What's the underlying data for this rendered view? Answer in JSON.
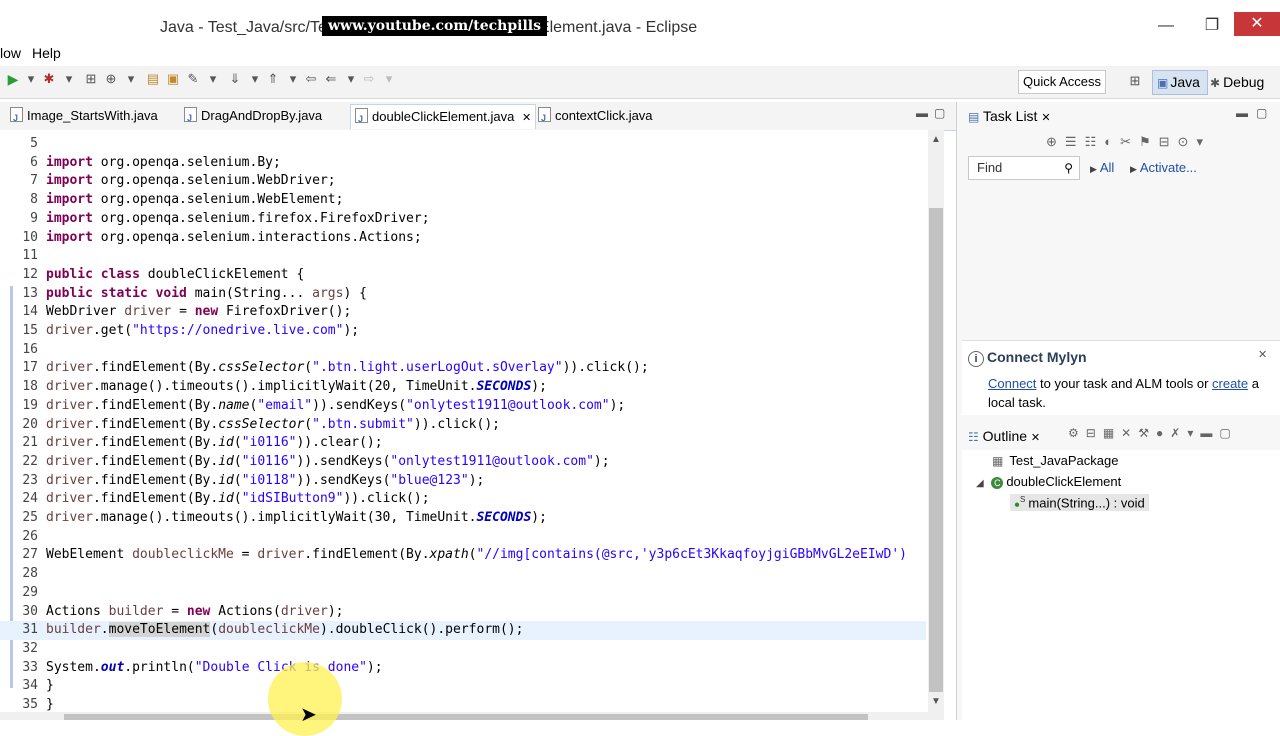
{
  "window": {
    "title": "Java - Test_Java/src/Te",
    "title_suffix": "Element.java - Eclipse",
    "watermark": "www.youtube.com/techpills",
    "min_symbol": "—",
    "max_symbol": "❐",
    "close_symbol": "✕"
  },
  "menu": {
    "items": [
      "low",
      "Help"
    ]
  },
  "toolbar": {
    "quick_access": "Quick Access",
    "perspectives": [
      "Java",
      "Debug"
    ]
  },
  "editor": {
    "tabs": [
      {
        "label": "Image_StartsWith.java",
        "active": false
      },
      {
        "label": "DragAndDropBy.java",
        "active": false
      },
      {
        "label": "doubleClickElement.java",
        "active": true,
        "close": "✕"
      },
      {
        "label": "contextClick.java",
        "active": false
      }
    ],
    "lines": [
      {
        "n": "5",
        "html": ""
      },
      {
        "n": "6",
        "html": "<span class='kw'>import</span> org.openqa.selenium.By;"
      },
      {
        "n": "7",
        "html": "<span class='kw'>import</span> org.openqa.selenium.WebDriver;"
      },
      {
        "n": "8",
        "html": "<span class='kw'>import</span> org.openqa.selenium.WebElement;"
      },
      {
        "n": "9",
        "html": "<span class='kw'>import</span> org.openqa.selenium.firefox.FirefoxDriver;"
      },
      {
        "n": "10",
        "html": "<span class='kw'>import</span> org.openqa.selenium.interactions.Actions;"
      },
      {
        "n": "11",
        "html": ""
      },
      {
        "n": "12",
        "html": "<span class='kw'>public class</span> doubleClickElement {"
      },
      {
        "n": "13",
        "html": "<span class='kw'>public static void</span> main(String... <span class='var'>args</span>) {"
      },
      {
        "n": "14",
        "html": "WebDriver <span class='var'>driver</span> = <span class='kw'>new</span> FirefoxDriver();"
      },
      {
        "n": "15",
        "html": "<span class='var'>driver</span>.get(<span class='str'>\"https://onedrive.live.com\"</span>);"
      },
      {
        "n": "16",
        "html": ""
      },
      {
        "n": "17",
        "html": "<span class='var'>driver</span>.findElement(By.<span class='it'>cssSelector</span>(<span class='str'>\".btn.light.userLogOut.sOverlay\"</span>)).click();"
      },
      {
        "n": "18",
        "html": "<span class='var'>driver</span>.manage().timeouts().implicitlyWait(20, TimeUnit.<span class='static'>SECONDS</span>);"
      },
      {
        "n": "19",
        "html": "<span class='var'>driver</span>.findElement(By.<span class='it'>name</span>(<span class='str'>\"email\"</span>)).sendKeys(<span class='str'>\"onlytest1911@outlook.com\"</span>);"
      },
      {
        "n": "20",
        "html": "<span class='var'>driver</span>.findElement(By.<span class='it'>cssSelector</span>(<span class='str'>\".btn.submit\"</span>)).click();"
      },
      {
        "n": "21",
        "html": "<span class='var'>driver</span>.findElement(By.<span class='it'>id</span>(<span class='str'>\"i0116\"</span>)).clear();"
      },
      {
        "n": "22",
        "html": "<span class='var'>driver</span>.findElement(By.<span class='it'>id</span>(<span class='str'>\"i0116\"</span>)).sendKeys(<span class='str'>\"onlytest1911@outlook.com\"</span>);"
      },
      {
        "n": "23",
        "html": "<span class='var'>driver</span>.findElement(By.<span class='it'>id</span>(<span class='str'>\"i0118\"</span>)).sendKeys(<span class='str'>\"blue@123\"</span>);"
      },
      {
        "n": "24",
        "html": "<span class='var'>driver</span>.findElement(By.<span class='it'>id</span>(<span class='str'>\"idSIButton9\"</span>)).click();"
      },
      {
        "n": "25",
        "html": "<span class='var'>driver</span>.manage().timeouts().implicitlyWait(30, TimeUnit.<span class='static'>SECONDS</span>);"
      },
      {
        "n": "26",
        "html": ""
      },
      {
        "n": "27",
        "html": "WebElement <span class='var'>doubleclickMe</span> = <span class='var'>driver</span>.findElement(By.<span class='it'>xpath</span>(<span class='str'>\"//img[contains(@src,'y3p6cEt3KkaqfoyjgiGBbMvGL2eEIwD')</span>"
      },
      {
        "n": "28",
        "html": ""
      },
      {
        "n": "29",
        "html": ""
      },
      {
        "n": "30",
        "html": "Actions <span class='var'>builder</span> = <span class='kw'>new</span> Actions(<span class='var'>driver</span>);"
      },
      {
        "n": "31",
        "html": "<span class='var'>builder</span>.<span class='hl'>moveToElement</span>(<span class='var'>doubleclickMe</span>).doubleClick().perform();",
        "current": true
      },
      {
        "n": "32",
        "html": ""
      },
      {
        "n": "33",
        "html": "System.<span class='static'>out</span>.println(<span class='str'>\"Double Click is done\"</span>);"
      },
      {
        "n": "34",
        "html": "}"
      },
      {
        "n": "35",
        "html": "}"
      }
    ]
  },
  "task_list": {
    "title": "Task List",
    "find_placeholder": "Find",
    "all_label": "All",
    "activate_label": "Activate..."
  },
  "mylyn": {
    "title": "Connect Mylyn",
    "connect_link": "Connect",
    "text_mid": " to your task and ALM tools or ",
    "create_link": "create",
    "text_end": " a",
    "text_line2": "local task."
  },
  "outline": {
    "title": "Outline",
    "items": [
      {
        "label": "Test_JavaPackage",
        "level": 0
      },
      {
        "label": "doubleClickElement",
        "level": 1
      },
      {
        "label": "main(String...) : void",
        "level": 2
      }
    ]
  }
}
